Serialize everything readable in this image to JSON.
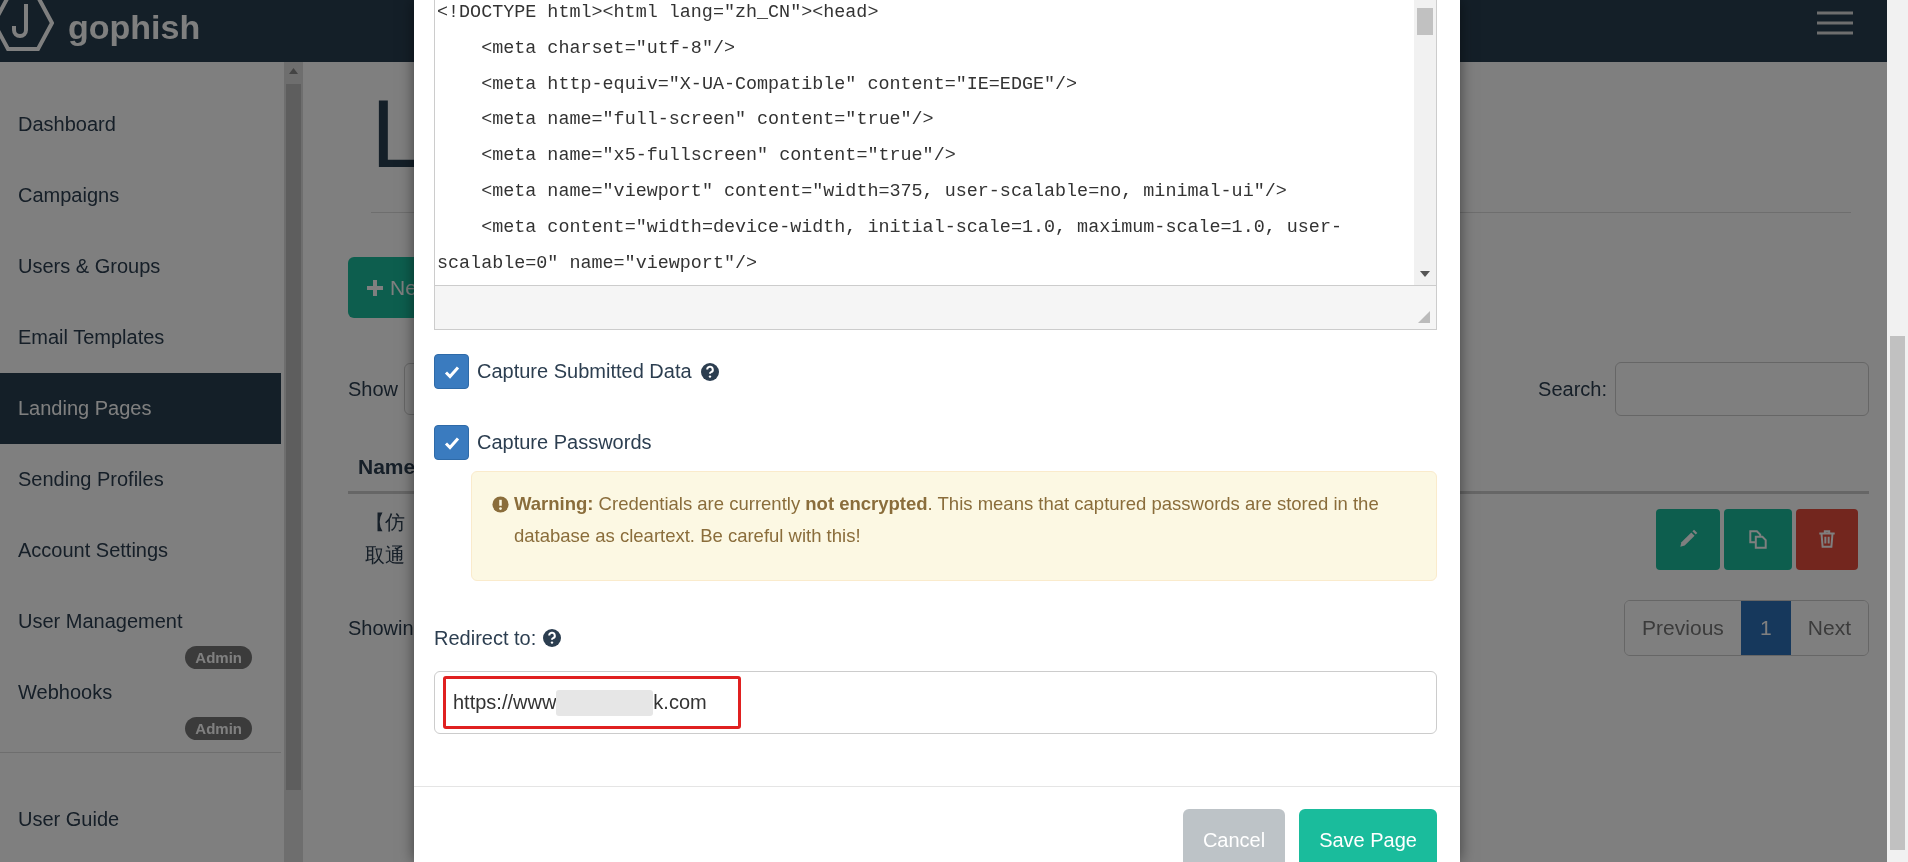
{
  "navbar": {
    "brand": "gophish"
  },
  "sidebar": {
    "items": [
      {
        "label": "Dashboard",
        "selected": false
      },
      {
        "label": "Campaigns",
        "selected": false
      },
      {
        "label": "Users & Groups",
        "selected": false
      },
      {
        "label": "Email Templates",
        "selected": false
      },
      {
        "label": "Landing Pages",
        "selected": true
      },
      {
        "label": "Sending Profiles",
        "selected": false
      },
      {
        "label": "Account Settings",
        "selected": false
      },
      {
        "label": "User Management",
        "selected": false,
        "badge": "Admin"
      },
      {
        "label": "Webhooks",
        "selected": false,
        "badge": "Admin"
      }
    ],
    "footer_items": [
      {
        "label": "User Guide",
        "selected": false
      }
    ]
  },
  "page": {
    "title": "L",
    "new_button": "Ne",
    "show_label": "Show",
    "search_label": "Search:",
    "table": {
      "columns": [
        "Name"
      ],
      "rows": [
        {
          "name_lines": [
            "【仿",
            "取通"
          ],
          "actions": [
            {
              "kind": "edit"
            },
            {
              "kind": "copy"
            },
            {
              "kind": "delete"
            }
          ]
        }
      ]
    },
    "info": "Showin",
    "pagination": {
      "previous": "Previous",
      "pages": [
        {
          "label": "1",
          "selected": true
        }
      ],
      "next": "Next"
    }
  },
  "modal": {
    "html_lines": [
      "<!DOCTYPE html><html lang=\"zh_CN\"><head>",
      "    <meta charset=\"utf-8\"/>",
      "    <meta http-equiv=\"X-UA-Compatible\" content=\"IE=EDGE\"/>",
      "    <meta name=\"full-screen\" content=\"true\"/>",
      "    <meta name=\"x5-fullscreen\" content=\"true\"/>",
      "    <meta name=\"viewport\" content=\"width=375, user-scalable=no, minimal-ui\"/>",
      "    <meta content=\"width=device-width, initial-scale=1.0, maximum-scale=1.0, user-scalable=0\" name=\"viewport\"/>"
    ],
    "checkboxes": [
      {
        "label": "Capture Submitted Data",
        "checked": true,
        "help": true
      },
      {
        "label": "Capture Passwords",
        "checked": true,
        "help": false
      }
    ],
    "warning": "**Warning:** Credentials are currently **not encrypted**. This means that captured passwords are stored in the database as cleartext. Be careful with this!",
    "redirect_label": "Redirect to:",
    "redirect_value_start": "https://www",
    "redirect_value_end": "k.com",
    "redirect_highlighted": true,
    "buttons": [
      {
        "label": "Cancel",
        "kind": "secondary"
      },
      {
        "label": "Save Page",
        "kind": "primary"
      }
    ]
  }
}
